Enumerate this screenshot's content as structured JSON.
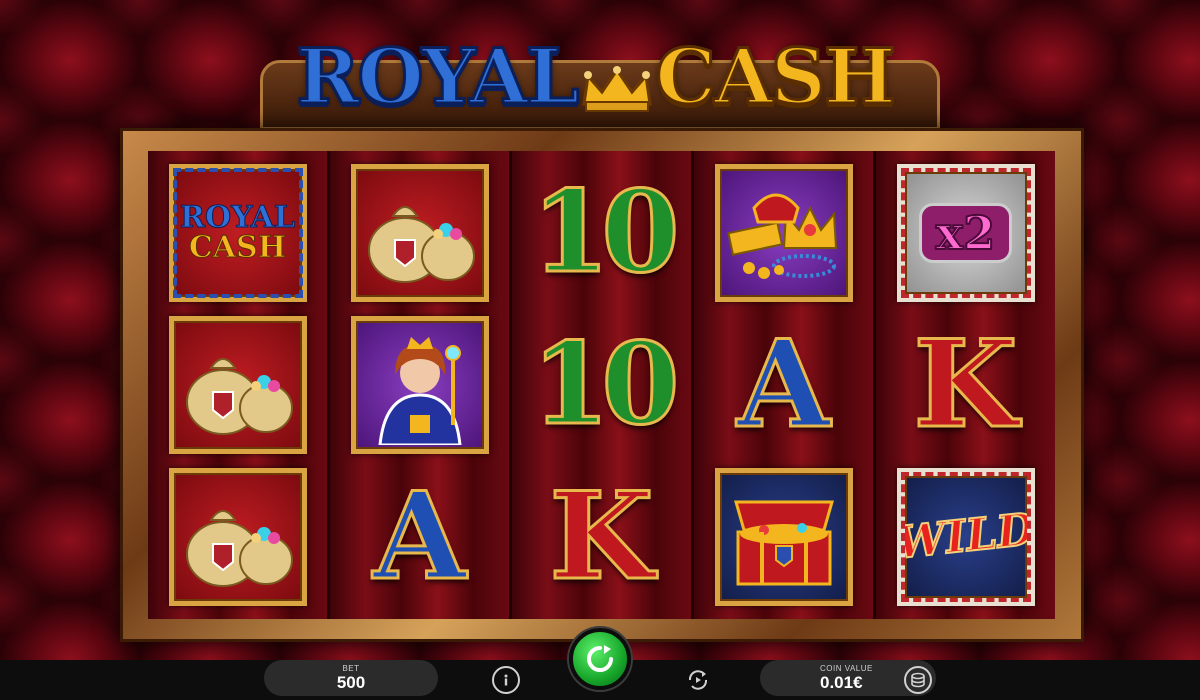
{
  "game": {
    "title_word_1": "ROYAL",
    "title_word_2": "CASH"
  },
  "reels": [
    [
      {
        "symbol": "royal-cash-logo",
        "tile": "royal",
        "line1": "ROYAL",
        "line2": "CASH"
      },
      {
        "symbol": "money-bags",
        "tile": "red"
      },
      {
        "symbol": "money-bags",
        "tile": "red"
      }
    ],
    [
      {
        "symbol": "money-bags",
        "tile": "red"
      },
      {
        "symbol": "queen",
        "tile": "purple"
      },
      {
        "symbol": "letter-a",
        "text": "A"
      }
    ],
    [
      {
        "symbol": "letter-10",
        "text": "10"
      },
      {
        "symbol": "letter-10",
        "text": "10"
      },
      {
        "symbol": "letter-k",
        "text": "K"
      }
    ],
    [
      {
        "symbol": "crown-jewels",
        "tile": "purple"
      },
      {
        "symbol": "letter-a",
        "text": "A"
      },
      {
        "symbol": "treasure-chest",
        "tile": "navy"
      }
    ],
    [
      {
        "symbol": "x2-multiplier",
        "tile": "gray",
        "text": "x2"
      },
      {
        "symbol": "letter-k",
        "text": "K"
      },
      {
        "symbol": "wild",
        "tile": "navy",
        "text": "WILD"
      }
    ]
  ],
  "controls": {
    "bet_label": "BET",
    "bet_value": "500",
    "coin_value_label": "COIN VALUE",
    "coin_value": "0.01€",
    "info_icon": "info-icon",
    "spin_icon": "spin-arrow-icon",
    "autoplay_icon": "autoplay-icon",
    "coins_icon": "coins-icon"
  },
  "colors": {
    "spin_green": "#17a62a",
    "frame_gold": "#d9a441",
    "royal_blue": "#2f6fd6",
    "cash_gold": "#f3b61f"
  }
}
